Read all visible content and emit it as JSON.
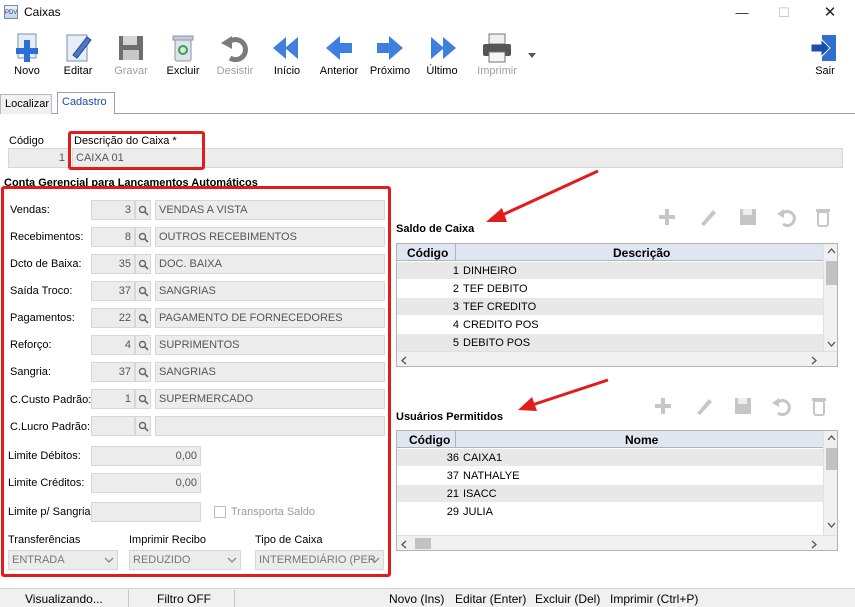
{
  "window": {
    "title": "Caixas",
    "icon_text": "PDV"
  },
  "toolbar": [
    {
      "label": "Novo",
      "icon": "new-icon",
      "enabled": true
    },
    {
      "label": "Editar",
      "icon": "edit-icon",
      "enabled": true
    },
    {
      "label": "Gravar",
      "icon": "save-icon",
      "enabled": false
    },
    {
      "label": "Excluir",
      "icon": "delete-icon",
      "enabled": true
    },
    {
      "label": "Desistir",
      "icon": "undo-icon",
      "enabled": false
    },
    {
      "label": "Início",
      "icon": "first-icon",
      "enabled": true
    },
    {
      "label": "Anterior",
      "icon": "previous-icon",
      "enabled": true
    },
    {
      "label": "Próximo",
      "icon": "next-icon",
      "enabled": true
    },
    {
      "label": "Último",
      "icon": "last-icon",
      "enabled": true
    },
    {
      "label": "Imprimir",
      "icon": "printer-icon",
      "enabled": false
    },
    {
      "label": "Sair",
      "icon": "exit-icon",
      "enabled": true
    }
  ],
  "tabs": [
    "Localizar",
    "Cadastro"
  ],
  "header": {
    "codigo_label": "Código",
    "codigo_value": "1",
    "descricao_label": "Descrição do Caixa *",
    "descricao_value": "CAIXA 01"
  },
  "conta_section": {
    "title": "Conta Gerencial para Lançamentos Automáticos"
  },
  "accounts": [
    {
      "label": "Vendas:",
      "code": "3",
      "desc": "VENDAS A VISTA"
    },
    {
      "label": "Recebimentos:",
      "code": "8",
      "desc": "OUTROS RECEBIMENTOS"
    },
    {
      "label": "Dcto de Baixa:",
      "code": "35",
      "desc": "DOC. BAIXA"
    },
    {
      "label": "Saída Troco:",
      "code": "37",
      "desc": "SANGRIAS"
    },
    {
      "label": "Pagamentos:",
      "code": "22",
      "desc": "PAGAMENTO DE FORNECEDORES"
    },
    {
      "label": "Reforço:",
      "code": "4",
      "desc": "SUPRIMENTOS"
    },
    {
      "label": "Sangria:",
      "code": "37",
      "desc": "SANGRIAS"
    },
    {
      "label": "C.Custo Padrão:",
      "code": "1",
      "desc": "SUPERMERCADO"
    },
    {
      "label": "C.Lucro Padrão:",
      "code": "",
      "desc": ""
    }
  ],
  "limits": {
    "debitos_label": "Limite Débitos:",
    "debitos_value": "0,00",
    "creditos_label": "Limite Créditos:",
    "creditos_value": "0,00",
    "sangria_label": "Limite p/ Sangria:",
    "sangria_value": "",
    "transporta_label": "Transporta Saldo"
  },
  "dropdowns": [
    {
      "label": "Transferências",
      "value": "ENTRADA"
    },
    {
      "label": "Imprimir Recibo",
      "value": "REDUZIDO"
    },
    {
      "label": "Tipo de Caixa",
      "value": "INTERMEDIÁRIO (PER"
    }
  ],
  "saldo": {
    "title": "Saldo de Caixa",
    "columns": [
      "Código",
      "Descrição"
    ],
    "rows": [
      {
        "code": "1",
        "desc": "DINHEIRO"
      },
      {
        "code": "2",
        "desc": "TEF DEBITO"
      },
      {
        "code": "3",
        "desc": "TEF CREDITO"
      },
      {
        "code": "4",
        "desc": "CREDITO POS"
      },
      {
        "code": "5",
        "desc": "DEBITO POS"
      }
    ]
  },
  "usuarios": {
    "title": "Usuários Permitidos",
    "columns": [
      "Código",
      "Nome"
    ],
    "rows": [
      {
        "code": "36",
        "name": "CAIXA1"
      },
      {
        "code": "37",
        "name": "NATHALYE"
      },
      {
        "code": "21",
        "name": "ISACC"
      },
      {
        "code": "29",
        "name": "JULIA"
      }
    ]
  },
  "statusbar": {
    "state": "Visualizando...",
    "filter": "Filtro OFF",
    "hint1": "Novo (Ins)",
    "hint2": "Editar (Enter)",
    "hint3": "Excluir (Del)",
    "hint4": "Imprimir (Ctrl+P)"
  },
  "colors": {
    "accent": "#1b4ea8",
    "annotation_red": "#e21b1b",
    "grid_header": "#dfe6f1"
  }
}
